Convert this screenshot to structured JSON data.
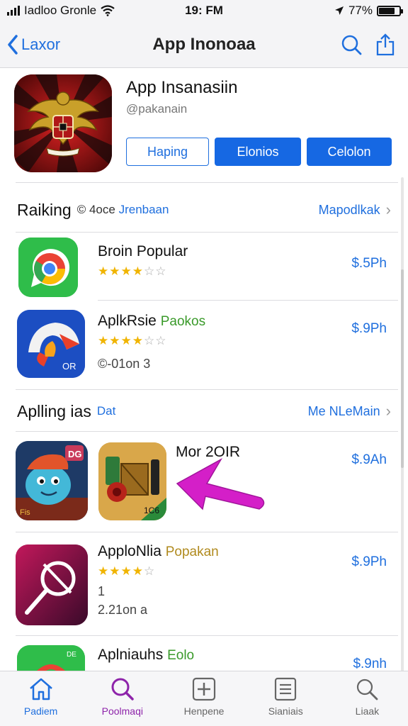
{
  "status": {
    "carrier": "Iadloo Gronle",
    "time": "19: FM",
    "battery": "77%"
  },
  "nav": {
    "back_label": "Laxor",
    "title": "App Inonoaa"
  },
  "app": {
    "name": "App Insanasiin",
    "developer": "@pakanain",
    "buttons": [
      "Haping",
      "Elonios",
      "Celolon"
    ]
  },
  "sections": [
    {
      "title": "Raiking",
      "subtitle_prefix": "© 4oce",
      "subtitle_accent": "Jrenbaan",
      "link": "Mapodlkak",
      "chevron": "›"
    },
    {
      "title": "Aplling ias",
      "subtitle_accent": "Dat",
      "link": "Me NLeMain",
      "chevron": "›"
    }
  ],
  "ranking_apps": [
    {
      "title": "Broin Popular",
      "accent": "",
      "rating": 3.5,
      "meta": "",
      "price": "$.5Ph"
    },
    {
      "title": "AplkRsie",
      "accent": "Paokos",
      "rating": 3.5,
      "meta": "©-01on 3",
      "price": "$.9Ph"
    }
  ],
  "featured": {
    "title": "Mor 2OIR",
    "price": "$.9Ah",
    "tile1_badge": "DG",
    "tile1_caption": "Fis",
    "tile2_caption": "1C6"
  },
  "more_apps": [
    {
      "title": "ApploNlia",
      "accent": "Popakan",
      "rating": 3.5,
      "meta1": "1",
      "meta2": "2.21on a",
      "price": "$.9Ph"
    },
    {
      "title": "Aplniauhs",
      "accent": "Eolo",
      "price": "$.9nh"
    }
  ],
  "tab_bar": [
    {
      "label": "Padiem",
      "icon": "home-icon"
    },
    {
      "label": "Poolmaqi",
      "icon": "search-icon"
    },
    {
      "label": "Henpene",
      "icon": "add-square-icon"
    },
    {
      "label": "Sianiais",
      "icon": "list-icon"
    },
    {
      "label": "Liaak",
      "icon": "search-outline-icon"
    }
  ],
  "colors": {
    "accent": "#1f6fde",
    "star": "#f0b400",
    "green_accent": "#3a9a2a",
    "gold_accent": "#b08a1e",
    "search_tab": "#8e24aa"
  }
}
